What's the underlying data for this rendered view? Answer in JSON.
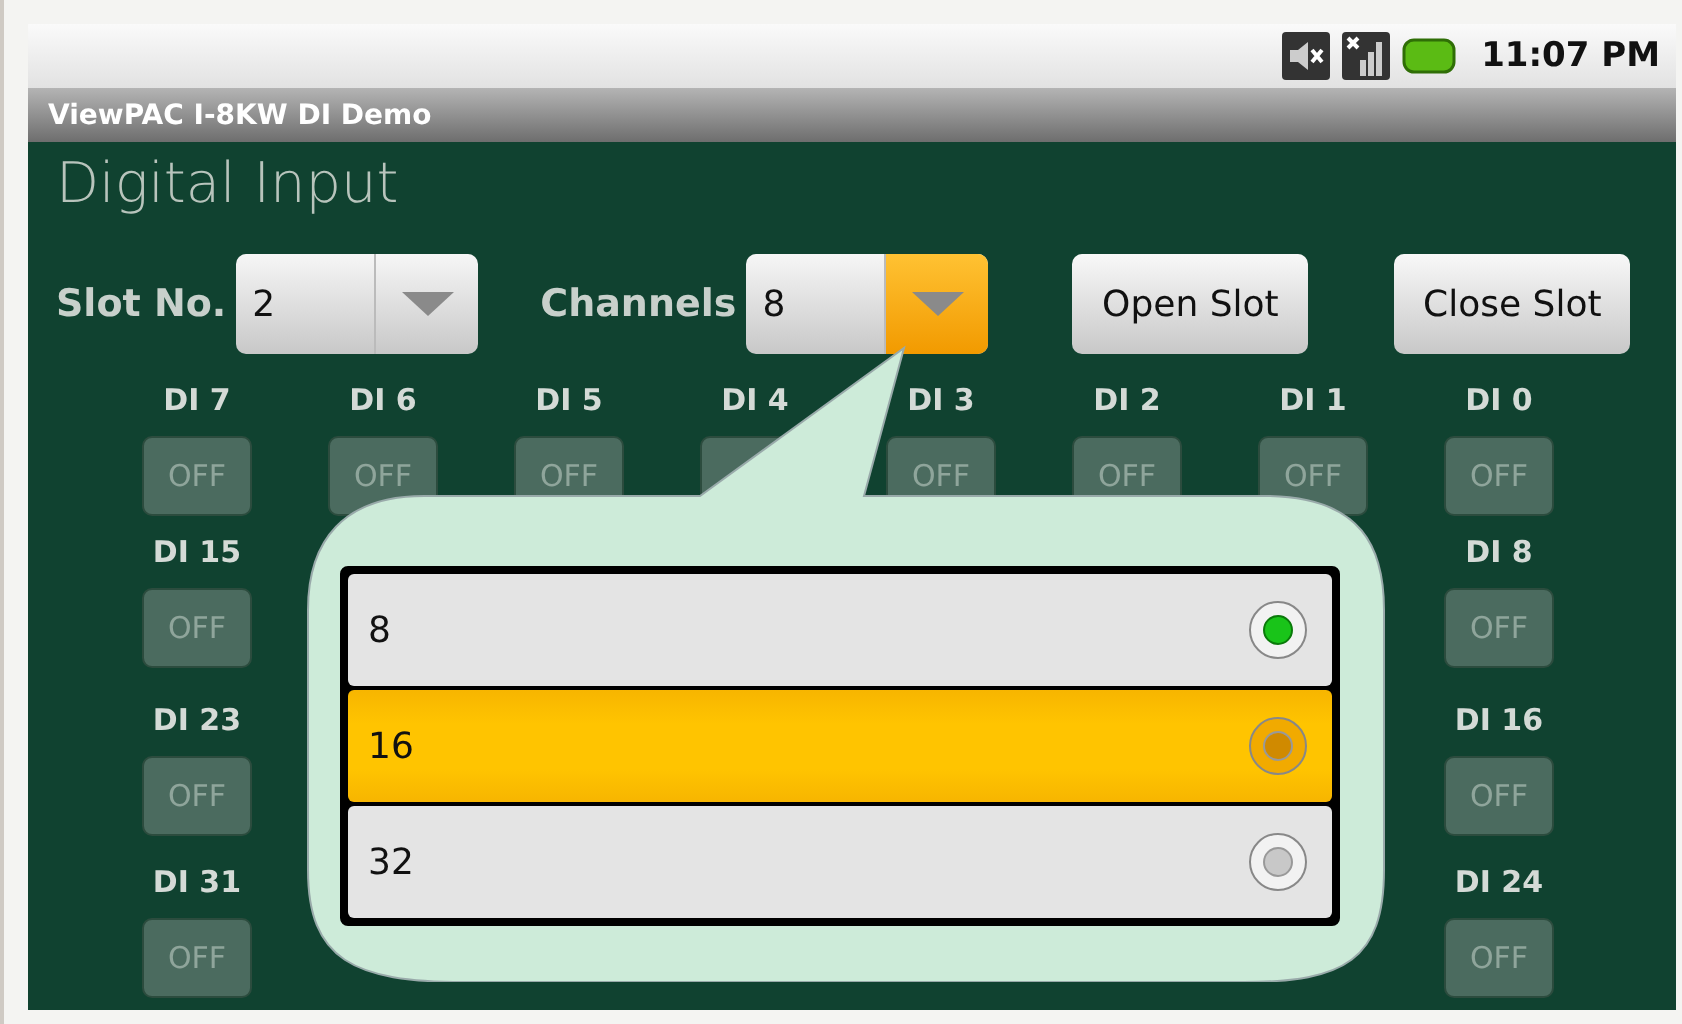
{
  "status_bar": {
    "time": "11:07 PM"
  },
  "window": {
    "title": "ViewPAC I-8KW DI Demo"
  },
  "heading": "Digital Input",
  "controls": {
    "slot_label": "Slot No.",
    "slot_value": "2",
    "channels_label": "Channels",
    "channels_value": "8",
    "channels_open": true,
    "buttons": [
      "Open Slot",
      "Close Slot"
    ]
  },
  "grid": [
    [
      {
        "label": "DI 7",
        "state": "OFF"
      },
      {
        "label": "DI 6",
        "state": "OFF"
      },
      {
        "label": "DI 5",
        "state": "OFF"
      },
      {
        "label": "DI 4"
      },
      {
        "label": "DI 3",
        "state": "OFF"
      },
      {
        "label": "DI 2",
        "state": "OFF"
      },
      {
        "label": "DI 1",
        "state": "OFF"
      },
      {
        "label": "DI 0",
        "state": "OFF"
      }
    ],
    [
      {
        "label": "DI 15",
        "state": "OFF"
      },
      {
        "label": "DI 8",
        "state": "OFF"
      }
    ],
    [
      {
        "label": "DI 23",
        "state": "OFF"
      },
      {
        "label": "DI 16",
        "state": "OFF"
      }
    ],
    [
      {
        "label": "DI 31",
        "state": "OFF"
      },
      {
        "label": "DI 24",
        "state": "OFF"
      }
    ]
  ],
  "options": [
    {
      "label": "8",
      "selected": true,
      "highlighted": false
    },
    {
      "label": "16",
      "selected": false,
      "highlighted": true
    },
    {
      "label": "32",
      "selected": false,
      "highlighted": false
    }
  ]
}
